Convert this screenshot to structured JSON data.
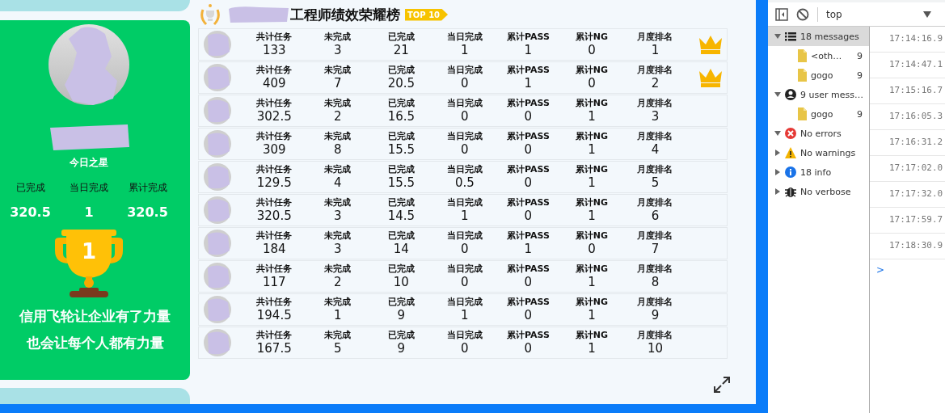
{
  "star": {
    "caption": "今日之星",
    "stats": [
      {
        "label": "已完成",
        "value": "320.5"
      },
      {
        "label": "当日完成",
        "value": "1"
      },
      {
        "label": "累计完成",
        "value": "320.5"
      }
    ],
    "trophy_number": "1",
    "slogan": [
      "信用飞轮让企业有了力量",
      "也会让每个人都有力量"
    ]
  },
  "board": {
    "title": "工程师绩效荣耀榜",
    "badge": "TOP 10",
    "rows": [
      {
        "crown": true,
        "stats": [
          {
            "label": "共计任务",
            "value": "133"
          },
          {
            "label": "未完成",
            "value": "3"
          },
          {
            "label": "已完成",
            "value": "21"
          },
          {
            "label": "当日完成",
            "value": "1"
          },
          {
            "label": "累计PASS",
            "value": "1"
          },
          {
            "label": "累计NG",
            "value": "0"
          },
          {
            "label": "月度排名",
            "value": "1"
          }
        ]
      },
      {
        "crown": true,
        "stats": [
          {
            "label": "共计任务",
            "value": "409"
          },
          {
            "label": "未完成",
            "value": "7"
          },
          {
            "label": "已完成",
            "value": "20.5"
          },
          {
            "label": "当日完成",
            "value": "0"
          },
          {
            "label": "累计PASS",
            "value": "1"
          },
          {
            "label": "累计NG",
            "value": "0"
          },
          {
            "label": "月度排名",
            "value": "2"
          }
        ]
      },
      {
        "crown": false,
        "stats": [
          {
            "label": "共计任务",
            "value": "302.5"
          },
          {
            "label": "未完成",
            "value": "2"
          },
          {
            "label": "已完成",
            "value": "16.5"
          },
          {
            "label": "当日完成",
            "value": "0"
          },
          {
            "label": "累计PASS",
            "value": "0"
          },
          {
            "label": "累计NG",
            "value": "1"
          },
          {
            "label": "月度排名",
            "value": "3"
          }
        ]
      },
      {
        "crown": false,
        "stats": [
          {
            "label": "共计任务",
            "value": "309"
          },
          {
            "label": "未完成",
            "value": "8"
          },
          {
            "label": "已完成",
            "value": "15.5"
          },
          {
            "label": "当日完成",
            "value": "0"
          },
          {
            "label": "累计PASS",
            "value": "0"
          },
          {
            "label": "累计NG",
            "value": "1"
          },
          {
            "label": "月度排名",
            "value": "4"
          }
        ]
      },
      {
        "crown": false,
        "stats": [
          {
            "label": "共计任务",
            "value": "129.5"
          },
          {
            "label": "未完成",
            "value": "4"
          },
          {
            "label": "已完成",
            "value": "15.5"
          },
          {
            "label": "当日完成",
            "value": "0.5"
          },
          {
            "label": "累计PASS",
            "value": "0"
          },
          {
            "label": "累计NG",
            "value": "1"
          },
          {
            "label": "月度排名",
            "value": "5"
          }
        ]
      },
      {
        "crown": false,
        "stats": [
          {
            "label": "共计任务",
            "value": "320.5"
          },
          {
            "label": "未完成",
            "value": "3"
          },
          {
            "label": "已完成",
            "value": "14.5"
          },
          {
            "label": "当日完成",
            "value": "1"
          },
          {
            "label": "累计PASS",
            "value": "0"
          },
          {
            "label": "累计NG",
            "value": "1"
          },
          {
            "label": "月度排名",
            "value": "6"
          }
        ]
      },
      {
        "crown": false,
        "stats": [
          {
            "label": "共计任务",
            "value": "184"
          },
          {
            "label": "未完成",
            "value": "3"
          },
          {
            "label": "已完成",
            "value": "14"
          },
          {
            "label": "当日完成",
            "value": "0"
          },
          {
            "label": "累计PASS",
            "value": "1"
          },
          {
            "label": "累计NG",
            "value": "0"
          },
          {
            "label": "月度排名",
            "value": "7"
          }
        ]
      },
      {
        "crown": false,
        "stats": [
          {
            "label": "共计任务",
            "value": "117"
          },
          {
            "label": "未完成",
            "value": "2"
          },
          {
            "label": "已完成",
            "value": "10"
          },
          {
            "label": "当日完成",
            "value": "0"
          },
          {
            "label": "累计PASS",
            "value": "0"
          },
          {
            "label": "累计NG",
            "value": "1"
          },
          {
            "label": "月度排名",
            "value": "8"
          }
        ]
      },
      {
        "crown": false,
        "stats": [
          {
            "label": "共计任务",
            "value": "194.5"
          },
          {
            "label": "未完成",
            "value": "1"
          },
          {
            "label": "已完成",
            "value": "9"
          },
          {
            "label": "当日完成",
            "value": "1"
          },
          {
            "label": "累计PASS",
            "value": "0"
          },
          {
            "label": "累计NG",
            "value": "1"
          },
          {
            "label": "月度排名",
            "value": "9"
          }
        ]
      },
      {
        "crown": false,
        "stats": [
          {
            "label": "共计任务",
            "value": "167.5"
          },
          {
            "label": "未完成",
            "value": "5"
          },
          {
            "label": "已完成",
            "value": "9"
          },
          {
            "label": "当日完成",
            "value": "0"
          },
          {
            "label": "累计PASS",
            "value": "0"
          },
          {
            "label": "累计NG",
            "value": "1"
          },
          {
            "label": "月度排名",
            "value": "10"
          }
        ]
      }
    ]
  },
  "devtools": {
    "context": "top",
    "sidebar": [
      {
        "kind": "messages",
        "label": "18 messages",
        "expanded": true,
        "selected": true,
        "children": [
          {
            "label": "<oth…",
            "count": "9"
          },
          {
            "label": "gogo",
            "count": "9"
          }
        ]
      },
      {
        "kind": "user",
        "label": "9 user mess…",
        "expanded": true,
        "selected": false,
        "children": [
          {
            "label": "gogo",
            "count": "9"
          }
        ]
      },
      {
        "kind": "error",
        "label": "No errors",
        "expanded": true,
        "selected": false
      },
      {
        "kind": "warning",
        "label": "No warnings",
        "expanded": false,
        "selected": false
      },
      {
        "kind": "info",
        "label": "18 info",
        "expanded": false,
        "selected": false
      },
      {
        "kind": "verbose",
        "label": "No verbose",
        "expanded": false,
        "selected": false
      }
    ],
    "log_times": [
      "17:14:16.9",
      "17:14:47.1",
      "17:15:16.7",
      "17:16:05.3",
      "17:16:31.2",
      "17:17:02.0",
      "17:17:32.0",
      "17:17:59.7",
      "17:18:30.9"
    ],
    "prompt": ">"
  }
}
